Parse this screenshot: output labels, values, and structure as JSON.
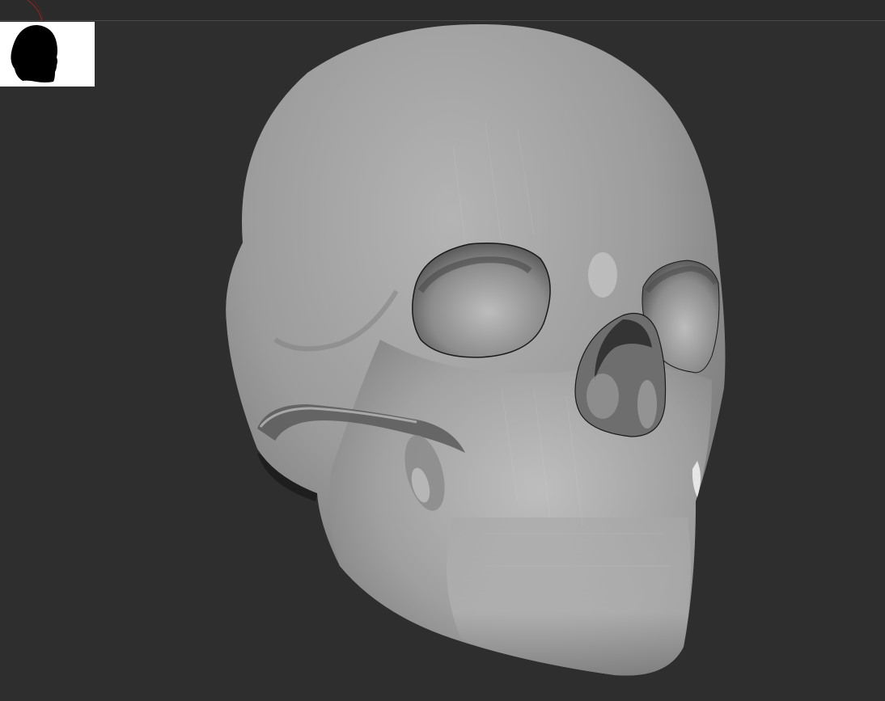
{
  "viewport": {
    "model_name": "skull",
    "background_color": "#2e2e2e",
    "material_color": "#9a9a9a"
  },
  "navigator": {
    "icon": "skull-silhouette-icon",
    "background_color": "#ffffff"
  }
}
